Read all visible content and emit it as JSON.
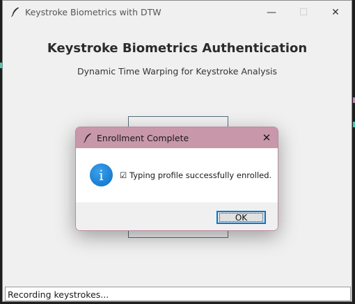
{
  "main_window": {
    "title": "Keystroke Biometrics with DTW",
    "heading": "Keystroke Biometrics Authentication",
    "subheading": "Dynamic Time Warping for Keystroke Analysis",
    "controls": {
      "minimize": "—",
      "maximize": "☐",
      "close": "✕"
    },
    "status": "Recording keystrokes..."
  },
  "dialog": {
    "title": "Enrollment Complete",
    "close": "✕",
    "icon": "info-icon",
    "icon_glyph": "i",
    "message": "☑ Typing profile successfully enrolled.",
    "ok_label": "OK"
  },
  "colors": {
    "dialog_titlebar": "#c897aa",
    "info_icon": "#0a70c8",
    "focus_border": "#0078d7"
  }
}
